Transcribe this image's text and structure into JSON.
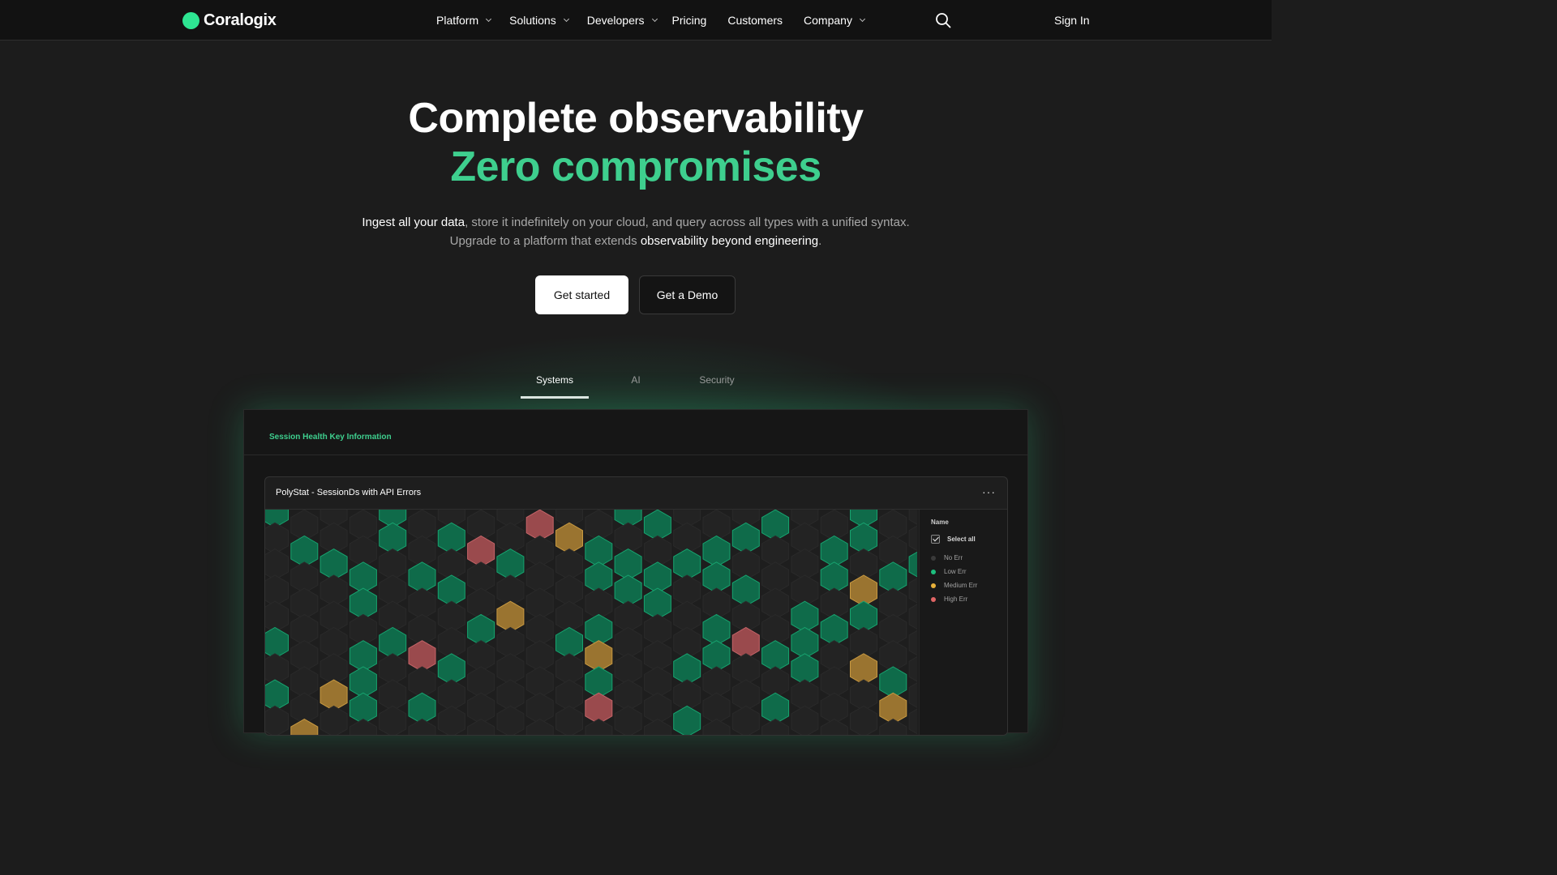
{
  "nav": {
    "logo_text": "Coralogix",
    "menu": [
      {
        "label": "Platform",
        "dropdown": true
      },
      {
        "label": "Solutions",
        "dropdown": true
      },
      {
        "label": "Developers",
        "dropdown": true
      },
      {
        "label": "Pricing",
        "dropdown": false
      },
      {
        "label": "Customers",
        "dropdown": false
      },
      {
        "label": "Company",
        "dropdown": true
      }
    ],
    "sign_in": "Sign In",
    "search_icon": "search-icon"
  },
  "hero": {
    "title_line1": "Complete observability",
    "title_line2": "Zero compromises",
    "subtitle_parts": [
      {
        "text": "Ingest all your data",
        "highlight": true
      },
      {
        "text": ", store it indefinitely on your cloud, and query across all types with a unified syntax. Upgrade to a platform that extends ",
        "highlight": false
      },
      {
        "text": "observability beyond engineering",
        "highlight": true
      },
      {
        "text": ".",
        "highlight": false
      }
    ],
    "primary_cta": "Get started",
    "secondary_cta": "Get a Demo"
  },
  "tabs": [
    {
      "label": "Systems",
      "active": true
    },
    {
      "label": "AI",
      "active": false
    },
    {
      "label": "Security",
      "active": false
    }
  ],
  "panel": {
    "title": "Session Health Key Information",
    "widget": {
      "title": "PolyStat - SessionDs with API Errors",
      "menu_glyph": "···",
      "legend": {
        "header": "Name",
        "select_all": "Select all",
        "items": [
          {
            "label": "No Err",
            "color": "#3a3a3a"
          },
          {
            "label": "Low Err",
            "color": "#1dbf7e"
          },
          {
            "label": "Medium Err",
            "color": "#e8b13a"
          },
          {
            "label": "High Err",
            "color": "#e06565"
          }
        ]
      }
    }
  },
  "colors": {
    "accent": "#3ecf8e",
    "hex_empty": "#232323",
    "hex_low": "#0f6b4a",
    "hex_medium": "#9a7430",
    "hex_high": "#9a4a4d"
  },
  "hexgrid": {
    "rows": [
      "G...G....R..GG...G..G....",
      ".G..G.GR..MG...GG..GG...M",
      "..GG.G..G..GGGGG...G.GGG.M",
      "...G..G.....GG..G...M....G",
      ".......GM..G...G..GGG...G.",
      "G..GGR....GM...GRGG....G.",
      "...G..G....G..G...G.MG...GR.",
      "G.MG.G.....R.....G...M.G",
      ".M............G........G..G"
    ]
  }
}
